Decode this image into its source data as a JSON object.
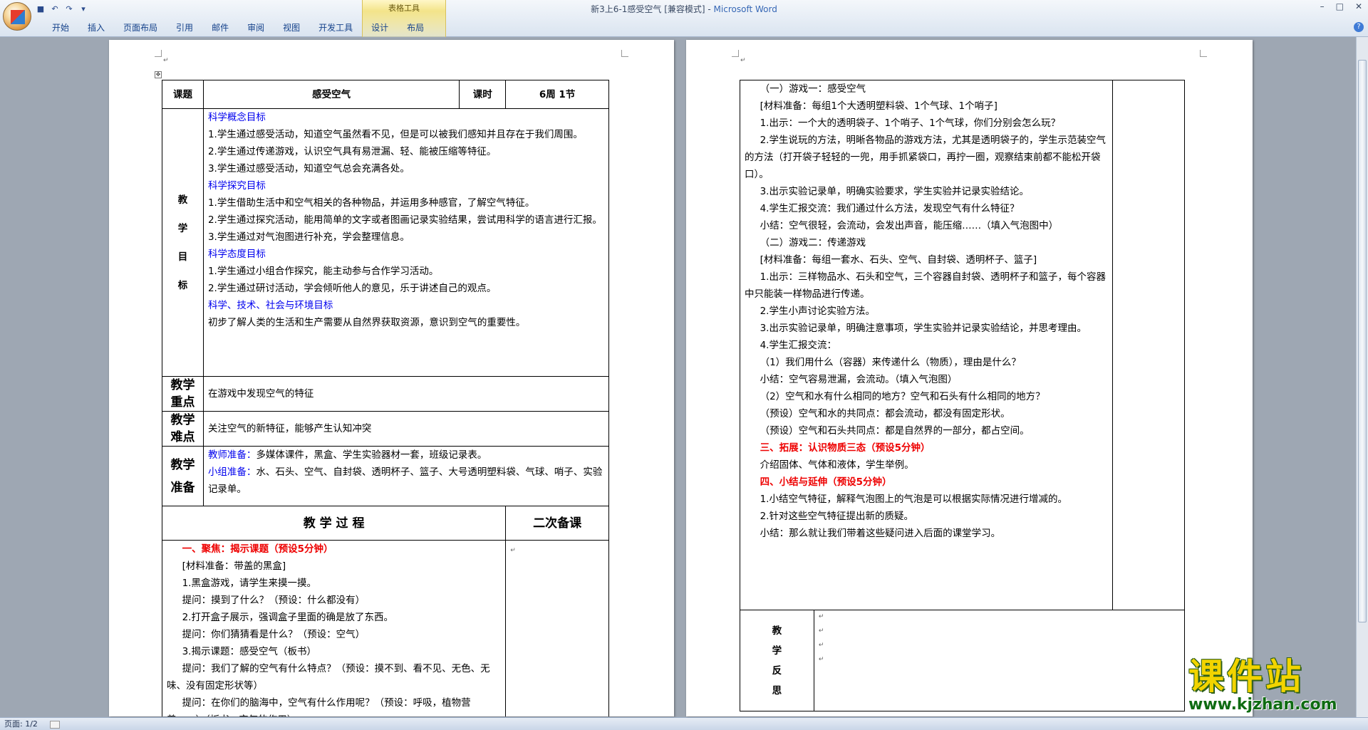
{
  "window": {
    "title": "新3上6-1感受空气 [兼容模式] - ",
    "app_name": "Microsoft Word",
    "context_tab_group": "表格工具"
  },
  "ribbon": {
    "tabs": [
      "开始",
      "插入",
      "页面布局",
      "引用",
      "邮件",
      "审阅",
      "视图",
      "开发工具",
      "设计",
      "布局"
    ]
  },
  "status": {
    "page": "页面: 1/2"
  },
  "watermark": {
    "main": "课件站",
    "url": "www.kjzhan.com"
  },
  "page1": {
    "h_topic": "课题",
    "topic": "感受空气",
    "h_period": "课时",
    "period": "6周 1节",
    "goals_label": [
      "教",
      "学",
      "目",
      "标"
    ],
    "goals": [
      {
        "type": "h",
        "text": "科学概念目标"
      },
      {
        "type": "p",
        "text": "1.学生通过感受活动，知道空气虽然看不见，但是可以被我们感知并且存在于我们周围。"
      },
      {
        "type": "p",
        "text": "2.学生通过传递游戏，认识空气具有易泄漏、轻、能被压缩等特征。"
      },
      {
        "type": "p",
        "text": "3.学生通过感受活动，知道空气总会充满各处。"
      },
      {
        "type": "h",
        "text": "科学探究目标"
      },
      {
        "type": "p",
        "text": "1.学生借助生活中和空气相关的各种物品，并运用多种感官，了解空气特征。"
      },
      {
        "type": "p",
        "text": "2.学生通过探究活动，能用简单的文字或者图画记录实验结果，尝试用科学的语言进行汇报。"
      },
      {
        "type": "p",
        "text": "3.学生通过对气泡图进行补充，学会整理信息。"
      },
      {
        "type": "h",
        "text": "科学态度目标"
      },
      {
        "type": "p",
        "text": "1.学生通过小组合作探究，能主动参与合作学习活动。"
      },
      {
        "type": "p",
        "text": "2.学生通过研讨活动，学会倾听他人的意见，乐于讲述自己的观点。"
      },
      {
        "type": "h",
        "text": "科学、技术、社会与环境目标"
      },
      {
        "type": "p",
        "text": "初步了解人类的生活和生产需要从自然界获取资源，意识到空气的重要性。"
      }
    ],
    "key_label": "教学重点",
    "key": "在游戏中发现空气的特征",
    "diff_label": "教学难点",
    "diff": "关注空气的新特征，能够产生认知冲突",
    "prep_label": "教学准备",
    "prep_teacher_h": "教师准备：",
    "prep_teacher": "多媒体课件，黑盒、学生实验器材一套，班级记录表。",
    "prep_group_h": "小组准备：",
    "prep_group": "水、石头、空气、自封袋、透明杯子、篮子、大号透明塑料袋、气球、哨子、实验记录单。",
    "process_label": "教 学 过 程",
    "second_label": "二次备课",
    "process": [
      {
        "type": "r",
        "text": "一、聚焦：揭示课题（预设5分钟）"
      },
      {
        "type": "p",
        "text": "[材料准备：带盖的黑盒]"
      },
      {
        "type": "p",
        "text": "1.黑盒游戏，请学生来摸一摸。"
      },
      {
        "type": "p",
        "text": "提问：摸到了什么？（预设：什么都没有）"
      },
      {
        "type": "p",
        "text": "2.打开盒子展示，强调盒子里面的确是放了东西。"
      },
      {
        "type": "p",
        "text": "提问：你们猜猜看是什么？（预设：空气）"
      },
      {
        "type": "p",
        "text": "3.揭示课题：感受空气（板书）"
      },
      {
        "type": "p",
        "text": "提问：我们了解的空气有什么特点？（预设：摸不到、看不见、无色、无味、没有固定形状等）"
      },
      {
        "type": "p",
        "text": "提问：在你们的脑海中，空气有什么作用呢？（预设：呼吸，植物营养……）（板书：空气的作用）"
      }
    ]
  },
  "page2": {
    "content": [
      {
        "type": "p",
        "text": "（一）游戏一：感受空气"
      },
      {
        "type": "p",
        "text": "[材料准备：每组1个大透明塑料袋、1个气球、1个哨子]"
      },
      {
        "type": "p",
        "text": "1.出示：一个大的透明袋子、1个哨子、1个气球，你们分别会怎么玩？"
      },
      {
        "type": "p",
        "text": "2.学生说玩的方法，明晰各物品的游戏方法，尤其是透明袋子的，学生示范装空气的方法（打开袋子轻轻的一兜，用手抓紧袋口，再拧一圈，观察结束前都不能松开袋口）。"
      },
      {
        "type": "p",
        "text": "3.出示实验记录单，明确实验要求，学生实验并记录实验结论。"
      },
      {
        "type": "p",
        "text": "4.学生汇报交流：我们通过什么方法，发现空气有什么特征？"
      },
      {
        "type": "p",
        "text": "小结：空气很轻，会流动，会发出声音，能压缩……（填入气泡图中）"
      },
      {
        "type": "p",
        "text": "（二）游戏二：传递游戏"
      },
      {
        "type": "p",
        "text": "[材料准备：每组一套水、石头、空气、自封袋、透明杯子、篮子]"
      },
      {
        "type": "p",
        "text": "1.出示：三样物品水、石头和空气，三个容器自封袋、透明杯子和篮子，每个容器中只能装一样物品进行传递。"
      },
      {
        "type": "p",
        "text": "2.学生小声讨论实验方法。"
      },
      {
        "type": "p",
        "text": "3.出示实验记录单，明确注意事项，学生实验并记录实验结论，并思考理由。"
      },
      {
        "type": "p",
        "text": "4.学生汇报交流："
      },
      {
        "type": "p",
        "text": "（1）我们用什么（容器）来传递什么（物质），理由是什么？"
      },
      {
        "type": "p",
        "text": "小结：空气容易泄漏，会流动。（填入气泡图）"
      },
      {
        "type": "p",
        "text": "（2）空气和水有什么相同的地方？空气和石头有什么相同的地方？"
      },
      {
        "type": "p",
        "text": "（预设）空气和水的共同点：都会流动，都没有固定形状。"
      },
      {
        "type": "p",
        "text": "（预设）空气和石头共同点：都是自然界的一部分，都占空间。"
      },
      {
        "type": "r",
        "text": "三、拓展：认识物质三态（预设5分钟）"
      },
      {
        "type": "p",
        "text": "介绍固体、气体和液体，学生举例。"
      },
      {
        "type": "r",
        "text": "四、小结与延伸（预设5分钟）"
      },
      {
        "type": "p",
        "text": "1.小结空气特征，解释气泡图上的气泡是可以根据实际情况进行增减的。"
      },
      {
        "type": "p",
        "text": "2.针对这些空气特征提出新的质疑。"
      },
      {
        "type": "p",
        "text": "小结：那么就让我们带着这些疑问进入后面的课堂学习。"
      }
    ],
    "reflect_label": [
      "教",
      "学",
      "反",
      "思"
    ]
  },
  "colors": {
    "blue_heading": "#0000ee",
    "red_heading": "#ee0000",
    "watermark_yellow": "#f2d400"
  }
}
